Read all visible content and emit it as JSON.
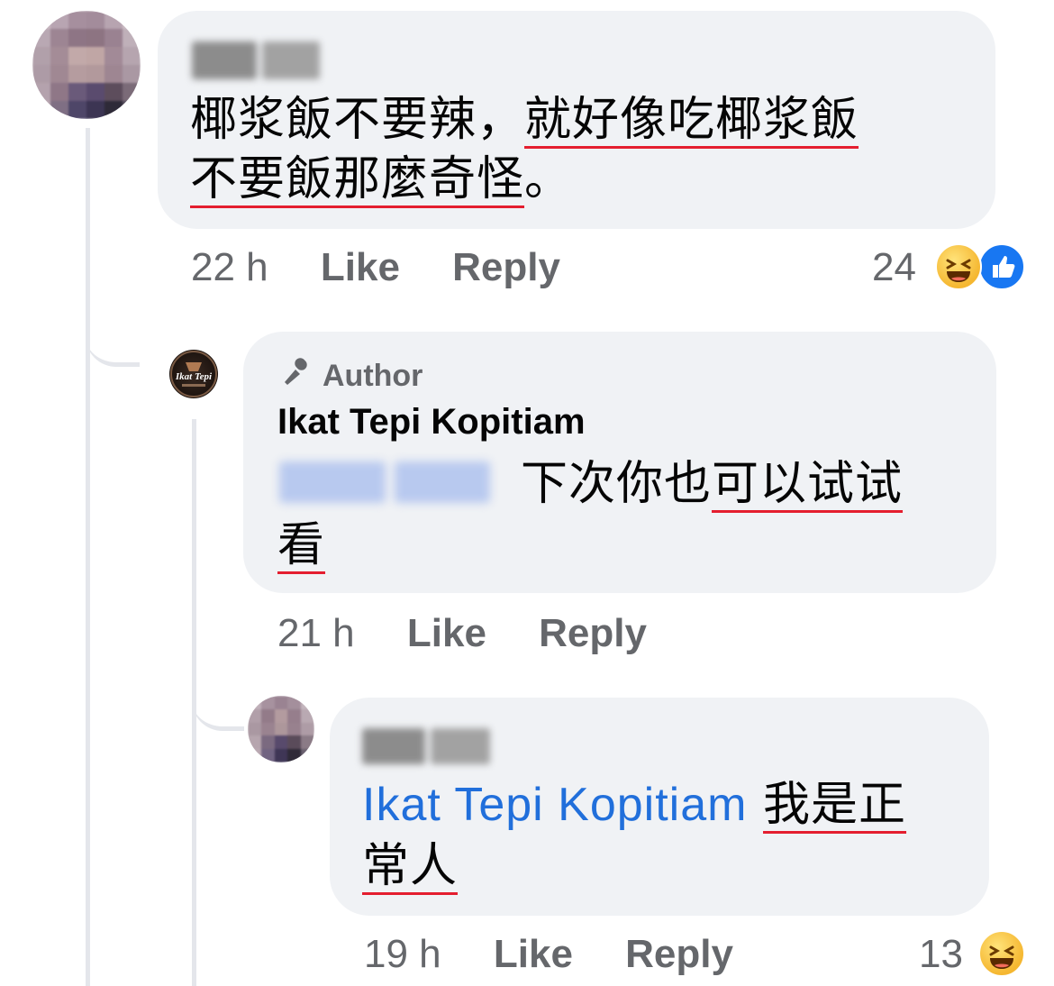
{
  "comment1": {
    "author_blurred": true,
    "text_plain": "椰浆飯不要辣，",
    "text_ul_line1": "就好像吃椰浆飯",
    "text_ul_line2": "不要飯那麼奇怪",
    "text_end": "。",
    "time": "22 h",
    "like_label": "Like",
    "reply_label": "Reply",
    "reaction_count": "24",
    "reactions": [
      "laugh-icon",
      "like-icon"
    ]
  },
  "reply1": {
    "badge_label": "Author",
    "author": "Ikat Tepi Kopitiam",
    "mention_blurred": true,
    "text_plain": "下次你也",
    "text_ul_line1": "可以试试",
    "text_ul_line2": "看",
    "time": "21 h",
    "like_label": "Like",
    "reply_label": "Reply",
    "avatar_text": "Ikat Tepi"
  },
  "reply2": {
    "author_blurred": true,
    "mention": "Ikat Tepi Kopitiam",
    "text_ul_line1": "我是正",
    "text_ul_line2": "常人",
    "time": "19 h",
    "like_label": "Like",
    "reply_label": "Reply",
    "reaction_count": "13",
    "reactions": [
      "laugh-icon"
    ]
  },
  "colors": {
    "bubble": "#f0f2f5",
    "meta": "#65676b",
    "mention": "#216fdb",
    "underline": "#e41e2f",
    "like_blue": "#1877f2"
  }
}
